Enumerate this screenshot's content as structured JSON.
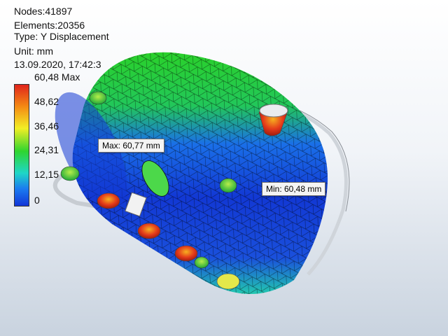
{
  "header": {
    "nodes": "Nodes:41897",
    "elements": "Elements:20356",
    "type": "Type: Y Displacement",
    "unit": "Unit: mm",
    "timestamp": "13.09.2020, 17:42:3"
  },
  "legend": {
    "labels": [
      "60,48 Max",
      "48,62",
      "36,46",
      "24,31",
      "12,15",
      "0"
    ],
    "colors": [
      "#e0241c",
      "#f48a14",
      "#f2ee25",
      "#2fd52f",
      "#1fd6c7",
      "#1b7bf0",
      "#1236d8"
    ]
  },
  "probes": {
    "max": "Max: 60,77 mm",
    "min": "Min: 60,48 mm"
  },
  "colors": {
    "background_top": "#ffffff",
    "background_bottom": "#c9d3df",
    "mesh_line": "#000000"
  }
}
